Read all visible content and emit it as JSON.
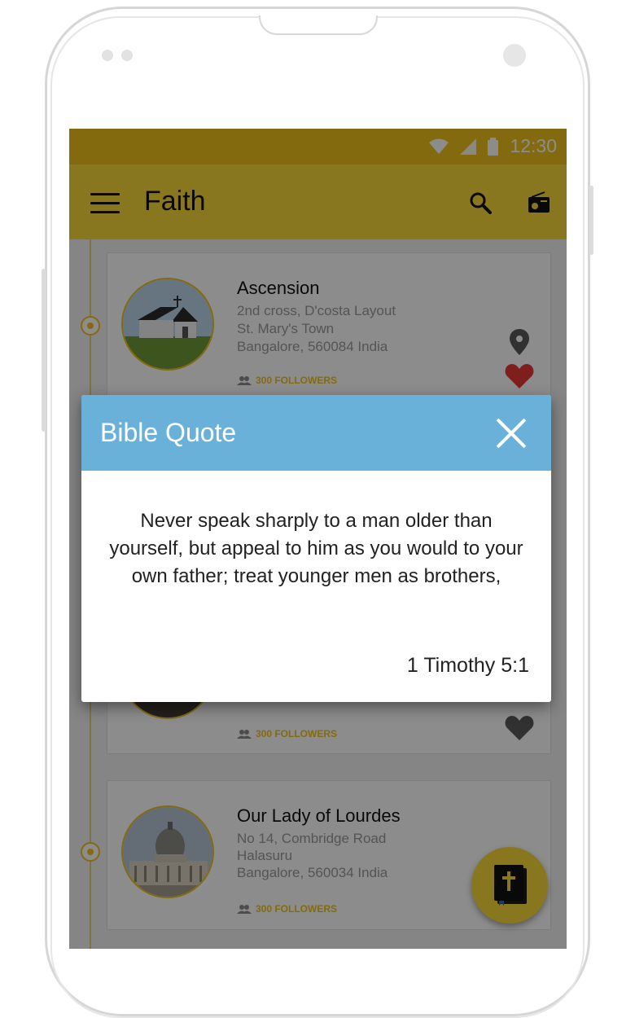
{
  "status_bar": {
    "time": "12:30"
  },
  "app_bar": {
    "title": "Faith",
    "icons": [
      "menu-icon",
      "search-icon",
      "radio-icon"
    ]
  },
  "churches": [
    {
      "name": "Ascension",
      "address_line1": "2nd cross, D'costa Layout",
      "address_line2": "St. Mary's Town",
      "address_line3": "Bangalore, 560084 India",
      "followers": "300 FOLLOWERS",
      "favorited": true
    },
    {
      "name": "",
      "address_line1": "",
      "address_line2": "",
      "address_line3": "",
      "followers": "300 FOLLOWERS",
      "favorited": false
    },
    {
      "name": "Our Lady of Lourdes",
      "address_line1": "No 14, Combridge Road",
      "address_line2": "Halasuru",
      "address_line3": "Bangalore, 560034 India",
      "followers": "300 FOLLOWERS",
      "favorited": false
    }
  ],
  "dialog": {
    "title": "Bible Quote",
    "quote": "Never speak sharply to a man older than yourself, but appeal to him as you would to your own father; treat younger men as brothers,",
    "reference": "1 Timothy 5:1"
  },
  "fab": {
    "icon": "bible-icon"
  },
  "colors": {
    "accent_yellow": "#f9d93a",
    "dialog_header_blue": "#6ab1d9",
    "favorite_red": "#e53935"
  }
}
